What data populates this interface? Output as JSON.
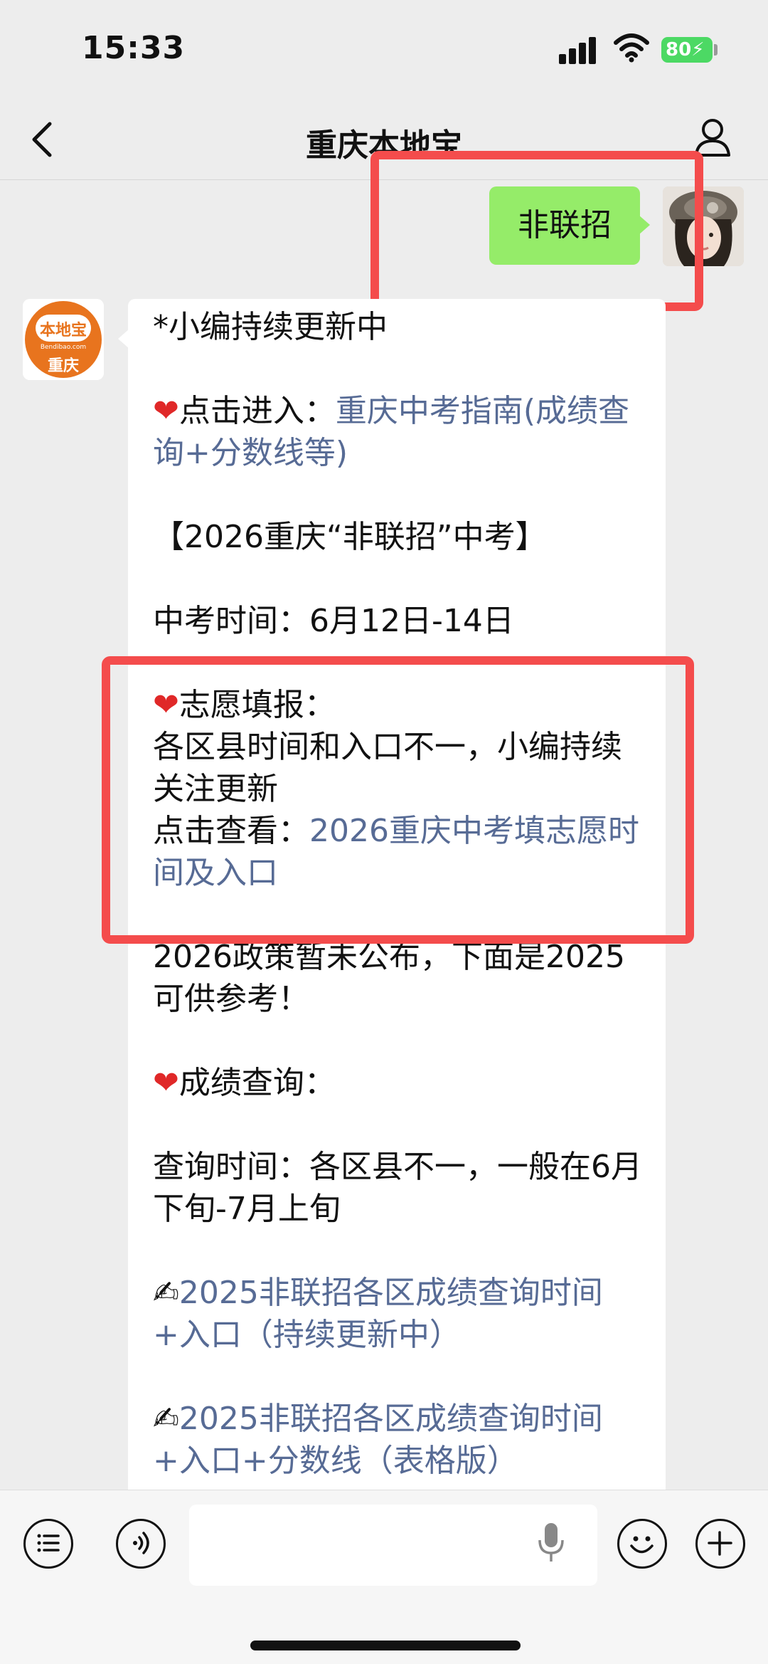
{
  "status_bar": {
    "time": "15:33",
    "battery": "80"
  },
  "nav": {
    "title": "重庆本地宝"
  },
  "sent_message": {
    "text": "非联招"
  },
  "bot_logo": {
    "line1": "本地宝",
    "line2": "Bendibao.com",
    "line3": "重庆"
  },
  "received_message": {
    "line1": "*小编持续更新中",
    "line2_prefix": "点击进入：",
    "line2_link": "重庆中考指南(成绩查询+分数线等)",
    "line3": "【2026重庆“非联招”中考】",
    "line4": "中考时间：6月12日-14日",
    "line5": "志愿填报：",
    "line6": "各区县时间和入口不一，小编持续关注更新",
    "line7_prefix": "点击查看：",
    "line7_link": "2026重庆中考填志愿时间及入口",
    "line8": "2026政策暂未公布，下面是2025可供参考！",
    "line9": "成绩查询：",
    "line10": "查询时间：各区县不一，一般在6月下旬-7月上旬",
    "link1": "2025非联招各区成绩查询时间+入口（持续更新中）",
    "link2": "2025非联招各区成绩查询时间+入口+分数线（表格版）"
  },
  "icons": {
    "back": "back-icon",
    "profile": "profile-icon",
    "menu": "menu-list-icon",
    "voice": "voice-icon",
    "mic": "microphone-icon",
    "emoji": "emoji-icon",
    "add": "add-icon"
  },
  "colors": {
    "sent_bubble": "#95ec69",
    "link": "#576b95",
    "highlight": "#f44c4c",
    "heart": "#e02828",
    "battery": "#4cd964",
    "logo_orange": "#e8741e"
  }
}
